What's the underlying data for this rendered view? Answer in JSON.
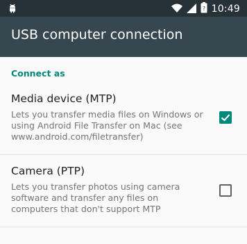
{
  "status_bar": {
    "time": "10:49",
    "icons": [
      "android-icon",
      "wifi-icon",
      "signal-icon",
      "battery-icon"
    ]
  },
  "app_bar": {
    "title": "USB computer connection"
  },
  "section": {
    "header": "Connect as"
  },
  "options": [
    {
      "title": "Media device (MTP)",
      "summary": "Lets you transfer media files on Windows or using Android File Transfer on Mac (see www.android.com/filetransfer)",
      "checked": true
    },
    {
      "title": "Camera (PTP)",
      "summary": "Lets you transfer photos using camera software and transfer any files on computers that don't support MTP",
      "checked": false
    }
  ],
  "colors": {
    "status_bar": "#263238",
    "app_bar": "#37474f",
    "accent": "#00897b"
  }
}
